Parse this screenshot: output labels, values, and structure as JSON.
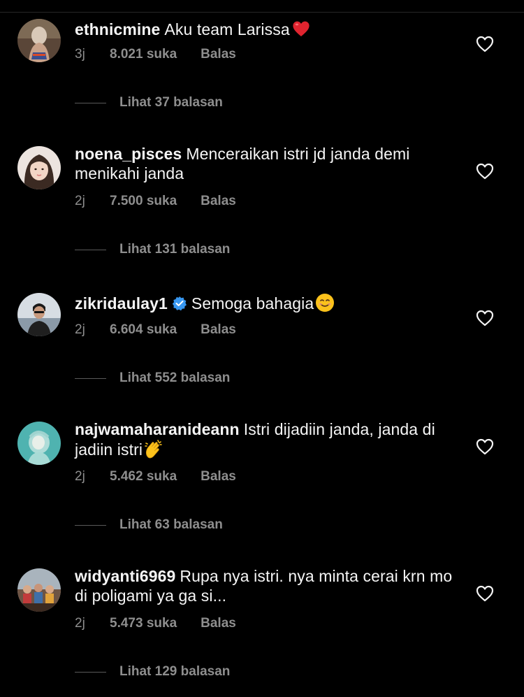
{
  "colors": {
    "background": "#000000",
    "primary_text": "#f5f5f5",
    "secondary_text": "#8e8e8e",
    "verified_blue": "#3897f0"
  },
  "comments": [
    {
      "username": "ethnicmine",
      "text": "Aku team Larissa",
      "emoji": "red-heart-emoji",
      "time": "3j",
      "likes": "8.021 suka",
      "reply_label": "Balas",
      "view_replies": "Lihat 37 balasan",
      "verified": false
    },
    {
      "username": "noena_pisces",
      "text": "Menceraikan istri jd janda  demi menikahi janda",
      "emoji": "",
      "time": "2j",
      "likes": "7.500 suka",
      "reply_label": "Balas",
      "view_replies": "Lihat 131 balasan",
      "verified": false
    },
    {
      "username": "zikridaulay1",
      "text": "Semoga bahagia",
      "emoji": "smiling-face-emoji",
      "time": "2j",
      "likes": "6.604 suka",
      "reply_label": "Balas",
      "view_replies": "Lihat 552 balasan",
      "verified": true
    },
    {
      "username": "najwamaharanideann",
      "text": "Istri dijadiin janda, janda di jadiin istri",
      "emoji": "clapping-hands-emoji",
      "time": "2j",
      "likes": "5.462 suka",
      "reply_label": "Balas",
      "view_replies": "Lihat 63 balasan",
      "verified": false
    },
    {
      "username": "widyanti6969",
      "text": "Rupa nya istri. nya minta cerai krn mo di poligami ya ga si...",
      "emoji": "",
      "time": "2j",
      "likes": "5.473 suka",
      "reply_label": "Balas",
      "view_replies": "Lihat 129 balasan",
      "verified": false
    }
  ]
}
